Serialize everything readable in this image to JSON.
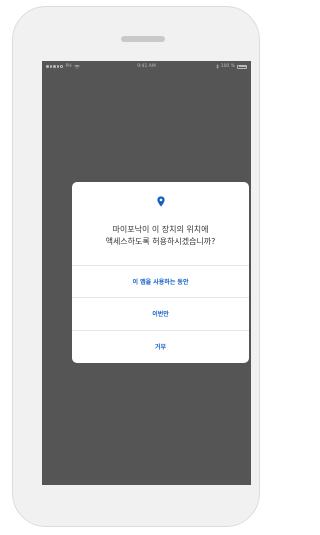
{
  "status_bar": {
    "carrier": "PH",
    "time": "9:41 AM",
    "battery": "100 %"
  },
  "dialog": {
    "icon": "location-pin-icon",
    "message_line1": "마이포낙이 이 장치의 위치에",
    "message_line2": "액세스하도록 허용하시겠습니까?",
    "buttons": [
      {
        "label": "이 앱을 사용하는 동안"
      },
      {
        "label": "이번만"
      },
      {
        "label": "거부"
      }
    ]
  },
  "colors": {
    "accent": "#1160c8",
    "overlay": "#555555",
    "dialog_bg": "#ffffff",
    "device_frame": "#f1f1f1"
  }
}
